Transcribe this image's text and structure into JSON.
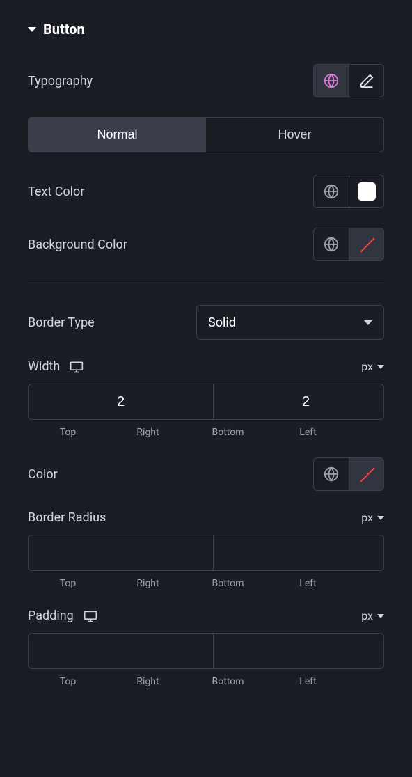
{
  "section": {
    "title": "Button"
  },
  "typography": {
    "label": "Typography"
  },
  "tabs": {
    "normal": "Normal",
    "hover": "Hover"
  },
  "textColor": {
    "label": "Text Color"
  },
  "backgroundColor": {
    "label": "Background Color"
  },
  "borderType": {
    "label": "Border Type",
    "value": "Solid"
  },
  "width": {
    "label": "Width",
    "unit": "px",
    "values": {
      "top": "2",
      "right": "2",
      "bottom": "2",
      "left": "2"
    },
    "sides": {
      "top": "Top",
      "right": "Right",
      "bottom": "Bottom",
      "left": "Left"
    }
  },
  "colorRow": {
    "label": "Color"
  },
  "borderRadius": {
    "label": "Border Radius",
    "unit": "px",
    "values": {
      "top": "",
      "right": "",
      "bottom": "",
      "left": ""
    },
    "sides": {
      "top": "Top",
      "right": "Right",
      "bottom": "Bottom",
      "left": "Left"
    }
  },
  "padding": {
    "label": "Padding",
    "unit": "px",
    "values": {
      "top": "",
      "right": "",
      "bottom": "",
      "left": ""
    },
    "sides": {
      "top": "Top",
      "right": "Right",
      "bottom": "Bottom",
      "left": "Left"
    }
  }
}
